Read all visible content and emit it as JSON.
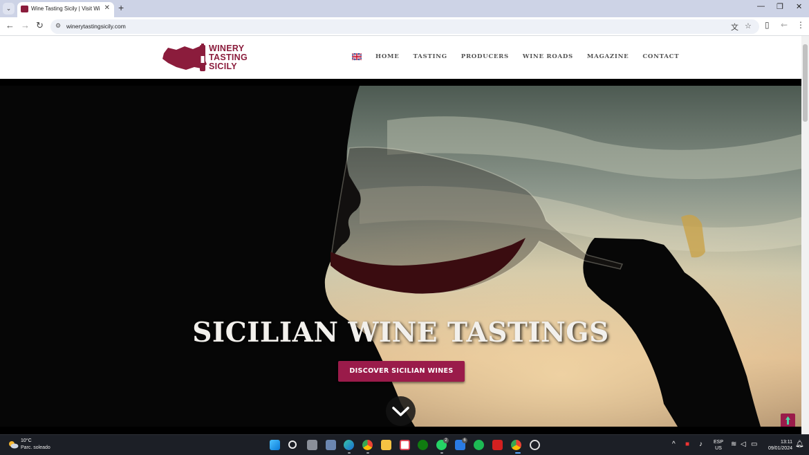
{
  "browser": {
    "tab_title": "Wine Tasting Sicily | Visit Wineries",
    "tab_close": "✕",
    "new_tab": "+",
    "url": "winerytastingsicily.com",
    "window_controls": [
      "—",
      "❐",
      "✕"
    ]
  },
  "site": {
    "logo": {
      "lines": [
        "WINERY",
        "TASTING",
        "SICILY"
      ],
      "color": "#8b1c3c"
    },
    "nav": [
      "HOME",
      "TASTING",
      "PRODUCERS",
      "WINE ROADS",
      "MAGAZINE",
      "CONTACT"
    ],
    "hero": {
      "title": "SICILIAN WINE TASTINGS",
      "cta": "DISCOVER SICILIAN WINES",
      "accent": "#9a1b4a"
    }
  },
  "taskbar": {
    "weather": {
      "temp": "10°C",
      "desc": "Parc. soleado"
    },
    "apps": [
      "start-icon",
      "search-icon",
      "task-view-icon",
      "file-icon",
      "edge-icon",
      "chrome-icon",
      "explorer-icon",
      "app-icon",
      "xbox-icon",
      "whatsapp-icon",
      "store-icon",
      "spotify-icon",
      "acrobat-icon",
      "chrome-active-icon",
      "settings-icon"
    ],
    "badges": {
      "whatsapp": "2",
      "store": "6"
    },
    "lang": [
      "ESP",
      "US"
    ],
    "time": "13:11",
    "date": "09/01/2024"
  }
}
